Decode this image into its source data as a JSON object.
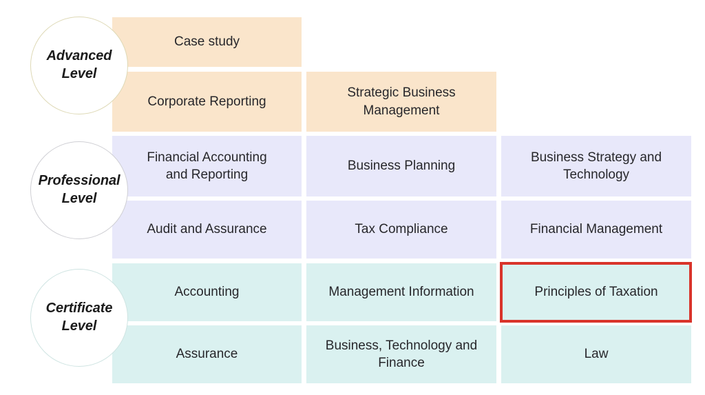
{
  "levels": [
    {
      "name": "advanced",
      "label": "Advanced\nLevel",
      "color": "#fae5cb",
      "ring": "#ded9b6"
    },
    {
      "name": "professional",
      "label": "Professional\nLevel",
      "color": "#e8e8fa",
      "ring": "#cfcfd4"
    },
    {
      "name": "certificate",
      "label": "Certificate\nLevel",
      "color": "#daf1f0",
      "ring": "#cfe4e2"
    }
  ],
  "modules": {
    "advanced": {
      "row1": {
        "col1": "Case study"
      },
      "row2": {
        "col1": "Corporate Reporting",
        "col2": "Strategic Business\nManagement"
      }
    },
    "professional": {
      "row1": {
        "col1": "Financial Accounting\nand Reporting",
        "col2": "Business Planning",
        "col3": "Business Strategy and\nTechnology"
      },
      "row2": {
        "col1": "Audit and Assurance",
        "col2": "Tax Compliance",
        "col3": "Financial Management"
      }
    },
    "certificate": {
      "row1": {
        "col1": "Accounting",
        "col2": "Management Information",
        "col3": "Principles of Taxation"
      },
      "row2": {
        "col1": "Assurance",
        "col2": "Business, Technology and\nFinance",
        "col3": "Law"
      }
    }
  },
  "highlight": {
    "target": "Principles of Taxation",
    "color": "#d9342b"
  }
}
